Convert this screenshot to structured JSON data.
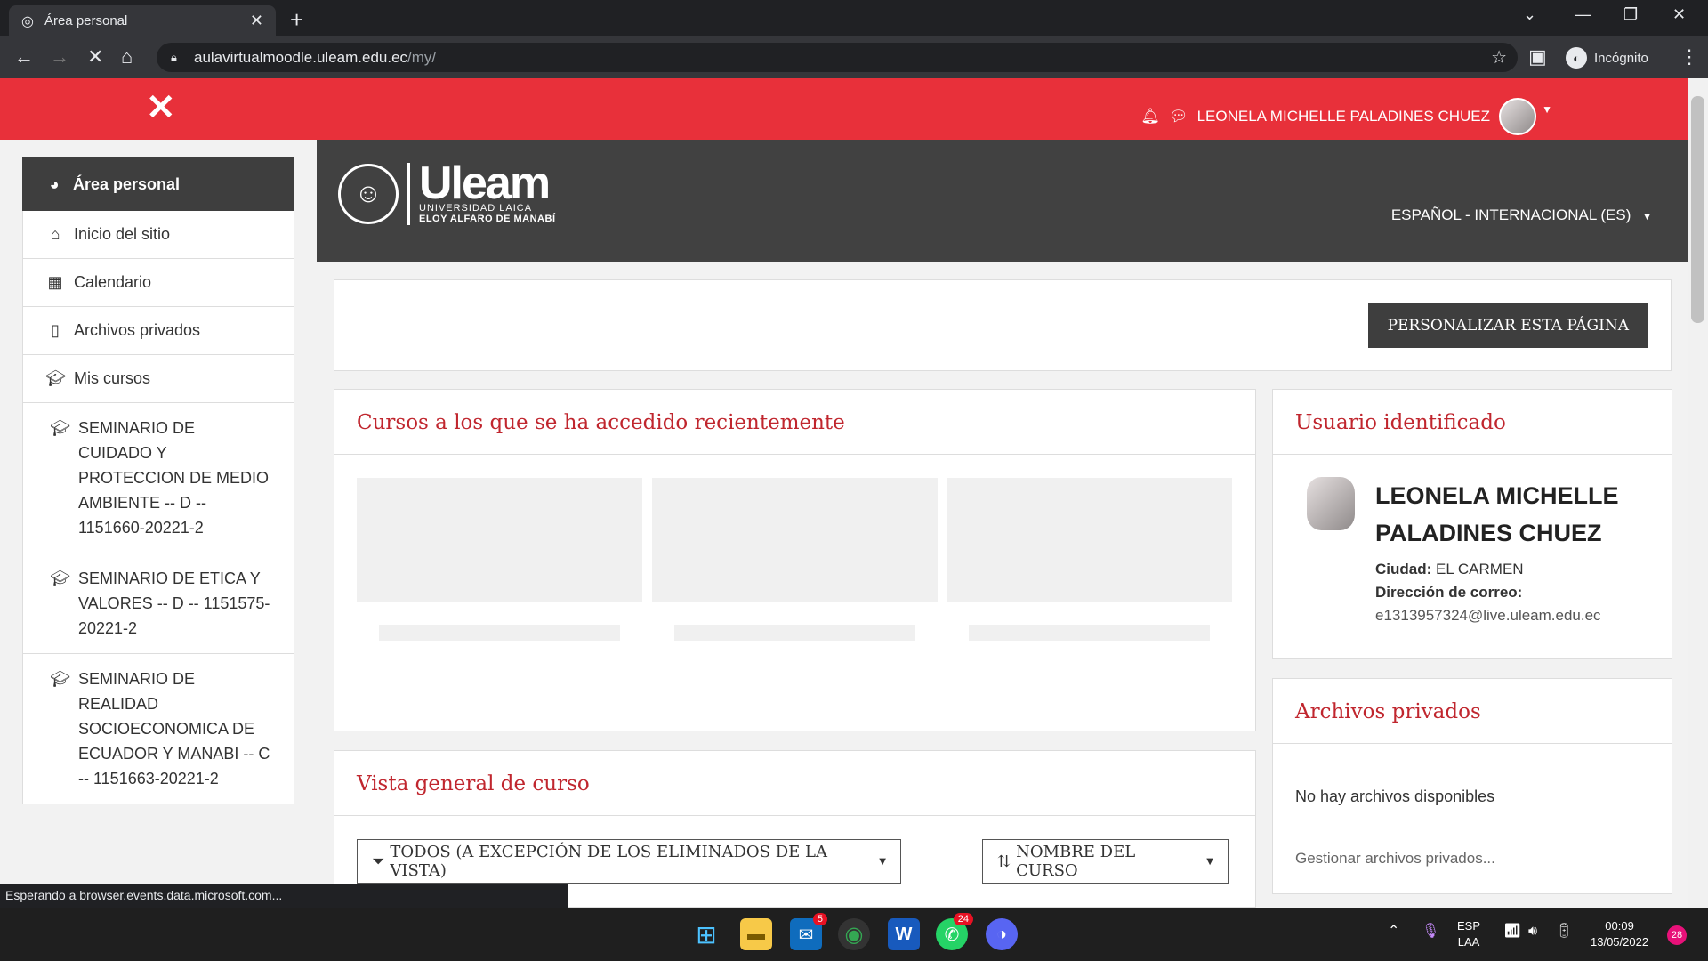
{
  "browser": {
    "tab_title": "Área personal",
    "url_host": "aulavirtualmoodle.uleam.edu.ec",
    "url_path": "/my/",
    "incognito_label": "Incógnito",
    "status_text": "Esperando a browser.events.data.microsoft.com..."
  },
  "header": {
    "user_name": "LEONELA MICHELLE PALADINES CHUEZ",
    "language": "ESPAÑOL - INTERNACIONAL (ES)"
  },
  "logo": {
    "name": "Uleam",
    "line1": "UNIVERSIDAD LAICA",
    "line2": "ELOY ALFARO DE MANABÍ"
  },
  "sidebar": {
    "items": [
      {
        "label": "Área personal",
        "icon": "dashboard-icon"
      },
      {
        "label": "Inicio del sitio",
        "icon": "home-icon"
      },
      {
        "label": "Calendario",
        "icon": "calendar-icon"
      },
      {
        "label": "Archivos privados",
        "icon": "file-icon"
      },
      {
        "label": "Mis cursos",
        "icon": "graduation-cap-icon"
      },
      {
        "label": "SEMINARIO DE CUIDADO Y PROTECCION DE MEDIO AMBIENTE -- D -- 1151660-20221-2",
        "icon": "graduation-cap-icon"
      },
      {
        "label": "SEMINARIO DE ETICA Y VALORES -- D -- 1151575-20221-2",
        "icon": "graduation-cap-icon"
      },
      {
        "label": "SEMINARIO DE REALIDAD SOCIOECONOMICA DE ECUADOR Y MANABI -- C -- 1151663-20221-2",
        "icon": "graduation-cap-icon"
      }
    ]
  },
  "main": {
    "customize_button": "PERSONALIZAR ESTA PÁGINA",
    "recent_title": "Cursos a los que se ha accedido recientemente",
    "overview_title": "Vista general de curso",
    "filter_label": "TODOS (A EXCEPCIÓN DE LOS ELIMINADOS DE LA VISTA)",
    "sort_label": "NOMBRE DEL CURSO"
  },
  "user_block": {
    "title": "Usuario identificado",
    "name": "LEONELA MICHELLE PALADINES CHUEZ",
    "city_label": "Ciudad:",
    "city_value": "EL CARMEN",
    "email_label": "Dirección de correo:",
    "email_value": "e1313957324@live.uleam.edu.ec"
  },
  "files_block": {
    "title": "Archivos privados",
    "empty_text": "No hay archivos disponibles",
    "manage_link": "Gestionar archivos privados..."
  },
  "taskbar": {
    "mail_badge": "5",
    "whatsapp_badge": "24",
    "lang_line1": "ESP",
    "lang_line2": "LAA",
    "time": "00:09",
    "date": "13/05/2022",
    "notif_count": "28"
  },
  "colors": {
    "accent_red": "#e8303a",
    "title_red": "#c0262e",
    "dark": "#3e3e3e"
  }
}
